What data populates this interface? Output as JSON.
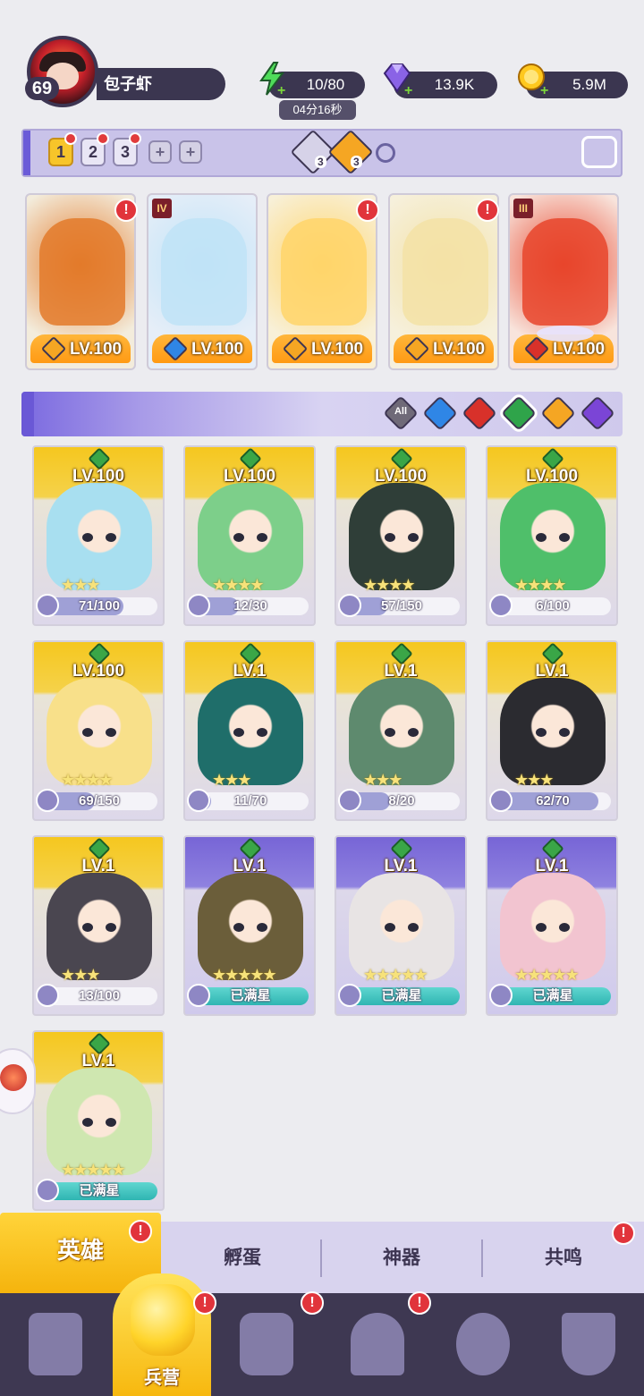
{
  "player": {
    "level": "69",
    "name": "包子虾"
  },
  "resources": {
    "energy": "10/80",
    "energy_timer": "04分16秒",
    "gems": "13.9K",
    "gold": "5.9M"
  },
  "team_bar": {
    "slots": [
      "1",
      "2",
      "3"
    ],
    "add_slots": [
      "+",
      "+"
    ],
    "attack_count": "3",
    "star_count": "3"
  },
  "squad": [
    {
      "level": "LV.100",
      "element": "light",
      "element_color": "#f5a623",
      "art_color": "#e37a2a"
    },
    {
      "level": "LV.100",
      "element": "water",
      "element_color": "#2f86e6",
      "art_color": "#bfe3f7",
      "badge": "IV"
    },
    {
      "level": "LV.100",
      "element": "light",
      "element_color": "#f5a623",
      "art_color": "#ffd56a"
    },
    {
      "level": "LV.100",
      "element": "light",
      "element_color": "#f5a623",
      "art_color": "#f3e2a6"
    },
    {
      "level": "LV.100",
      "element": "fire",
      "element_color": "#d8312a",
      "art_color": "#e8452c",
      "badge": "III"
    }
  ],
  "filters": [
    {
      "label": "All",
      "color": "#6f6a78",
      "icon": "all-icon"
    },
    {
      "label": "",
      "color": "#2f86e6",
      "icon": "water-icon"
    },
    {
      "label": "",
      "color": "#d8312a",
      "icon": "fire-icon"
    },
    {
      "label": "",
      "color": "#2fa44a",
      "icon": "wind-icon"
    },
    {
      "label": "",
      "color": "#f5a623",
      "icon": "light-icon"
    },
    {
      "label": "",
      "color": "#7b45d6",
      "icon": "dark-icon"
    }
  ],
  "heroes": [
    {
      "level": "LV.100",
      "progress": "71/100",
      "ratio": 0.71,
      "stars": "★★★",
      "frame": "gold",
      "art_color": "#a8dff0"
    },
    {
      "level": "LV.100",
      "progress": "12/30",
      "ratio": 0.4,
      "stars": "★★★★",
      "frame": "gold",
      "art_color": "#7dcf8a"
    },
    {
      "level": "LV.100",
      "progress": "57/150",
      "ratio": 0.38,
      "stars": "★★★★",
      "frame": "gold",
      "art_color": "#2f3e38"
    },
    {
      "level": "LV.100",
      "progress": "6/100",
      "ratio": 0.06,
      "stars": "★★★★",
      "frame": "gold",
      "art_color": "#4fbf6a"
    },
    {
      "level": "LV.100",
      "progress": "69/150",
      "ratio": 0.46,
      "stars": "★★★★",
      "frame": "gold",
      "art_color": "#f8e08a"
    },
    {
      "level": "LV.1",
      "progress": "11/70",
      "ratio": 0.16,
      "stars": "★★★",
      "frame": "gold",
      "art_color": "#1f6e6a"
    },
    {
      "level": "LV.1",
      "progress": "8/20",
      "ratio": 0.4,
      "stars": "★★★",
      "frame": "gold",
      "art_color": "#5e8a6e"
    },
    {
      "level": "LV.1",
      "progress": "62/70",
      "ratio": 0.89,
      "stars": "★★★",
      "frame": "gold",
      "art_color": "#2b2b30"
    },
    {
      "level": "LV.1",
      "progress": "13/100",
      "ratio": 0.13,
      "stars": "★★★",
      "frame": "gold",
      "art_color": "#4a4650"
    },
    {
      "level": "LV.1",
      "progress": "已满星",
      "ratio": 1,
      "stars": "★★★★★",
      "frame": "purple",
      "art_color": "#6b5e3a",
      "full": true
    },
    {
      "level": "LV.1",
      "progress": "已满星",
      "ratio": 1,
      "stars": "★★★★★",
      "frame": "purple",
      "art_color": "#e8e4e4",
      "full": true
    },
    {
      "level": "LV.1",
      "progress": "已满星",
      "ratio": 1,
      "stars": "★★★★★",
      "frame": "purple",
      "art_color": "#f2c4d0",
      "full": true
    },
    {
      "level": "LV.1",
      "progress": "已满星",
      "ratio": 1,
      "stars": "★★★★★",
      "frame": "gold",
      "art_color": "#cfe7b0",
      "full": true
    }
  ],
  "tabs": {
    "heroes": "英雄",
    "hatch": "孵蛋",
    "artifact": "神器",
    "resonance": "共鸣",
    "alert": "!"
  },
  "nav": {
    "barracks": "兵营"
  }
}
